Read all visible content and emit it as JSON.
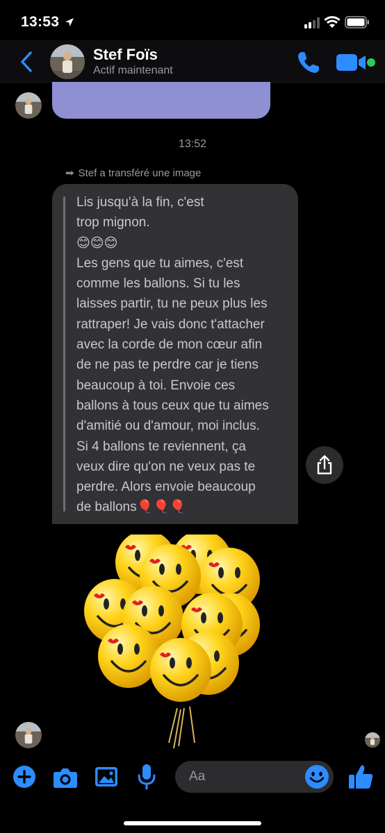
{
  "status_bar": {
    "time": "13:53"
  },
  "header": {
    "contact_name": "Stef Foïs",
    "presence": "Actif maintenant",
    "accent": "#2d8cff",
    "online_color": "#31c75a"
  },
  "conversation": {
    "timestamp": "13:52",
    "forward_note": "Stef a transféré une image",
    "forwarded_text": "Lis jusqu'à la fin, c'est\ntrop mignon.\n😊😊😊\nLes gens que tu aimes, c'est\ncomme les ballons. Si tu les\nlaisses partir, tu ne peux plus les\nrattraper! Je vais donc t'attacher\navec la corde de mon cœur afin\nde ne pas te perdre car je tiens\nbeaucoup à toi. Envoie ces\nballons à tous ceux que tu aimes\nd'amitié ou d'amour, moi inclus.\nSi 4 ballons te reviennent, ça\nveux dire qu'on ne veux pas te\nperdre. Alors envoie beaucoup\nde ballons🎈🎈🎈",
    "top_bubble_color": "#8f8fd4",
    "quote_bubble_color": "#323234"
  },
  "composer": {
    "placeholder": "Aa",
    "icons": [
      "plus-icon",
      "camera-icon",
      "image-icon",
      "microphone-icon",
      "emoji-icon",
      "thumbs-up-icon"
    ]
  }
}
